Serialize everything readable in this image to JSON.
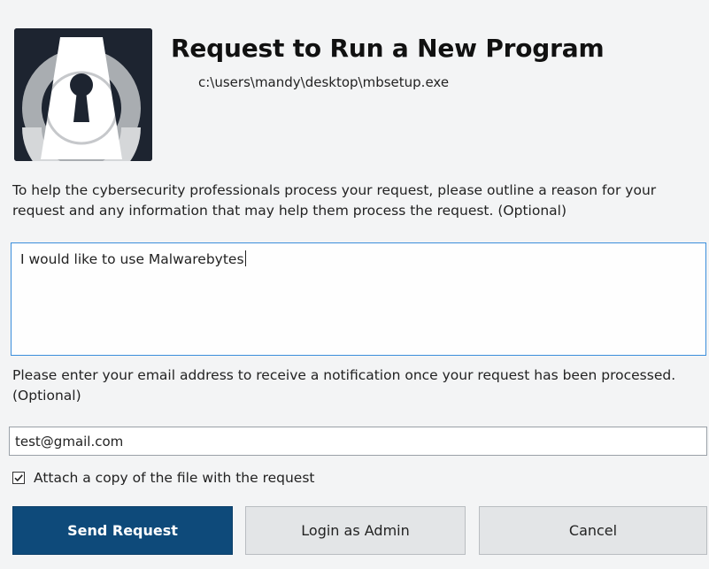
{
  "dialog": {
    "title": "Request to Run a New Program",
    "file_path": "c:\\users\\mandy\\desktop\\mbsetup.exe",
    "instructions": "To help the cybersecurity professionals process your request, please outline a reason for your request and any information that may help them process the request. (Optional)",
    "reason_value": "I would like to use Malwarebytes",
    "email_label": "Please enter your email address to receive a notification once your request has been processed. (Optional)",
    "email_value": "test@gmail.com",
    "attach_checked": true,
    "attach_label": "Attach a copy of the file with the request"
  },
  "buttons": {
    "send": "Send Request",
    "login": "Login as Admin",
    "cancel": "Cancel"
  },
  "colors": {
    "primary_button": "#0e4a7a",
    "focus_border": "#3b8edb",
    "logo_background": "#1d2430"
  },
  "icons": {
    "logo": "keyhole-lock-icon",
    "checkbox": "checkmark-icon"
  }
}
